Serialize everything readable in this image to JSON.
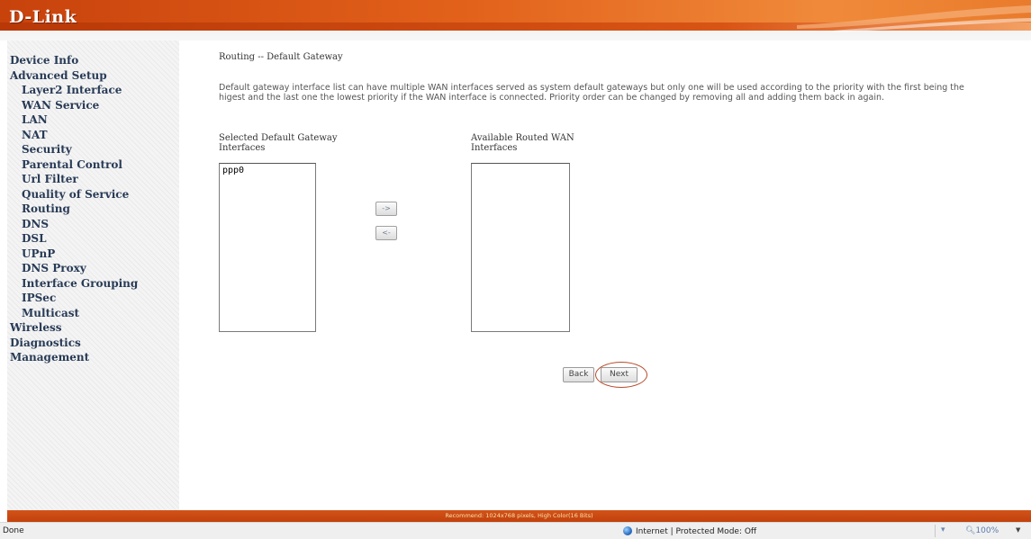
{
  "brand": {
    "logo_text": "D-Link"
  },
  "sidebar": {
    "items": [
      {
        "label": "Device Info",
        "level": 0
      },
      {
        "label": "Advanced Setup",
        "level": 0
      },
      {
        "label": "Layer2 Interface",
        "level": 1
      },
      {
        "label": "WAN Service",
        "level": 1
      },
      {
        "label": "LAN",
        "level": 1
      },
      {
        "label": "NAT",
        "level": 1
      },
      {
        "label": "Security",
        "level": 1
      },
      {
        "label": "Parental Control",
        "level": 1
      },
      {
        "label": "Url Filter",
        "level": 1
      },
      {
        "label": "Quality of Service",
        "level": 1
      },
      {
        "label": "Routing",
        "level": 1
      },
      {
        "label": "DNS",
        "level": 1
      },
      {
        "label": "DSL",
        "level": 1
      },
      {
        "label": "UPnP",
        "level": 1
      },
      {
        "label": "DNS Proxy",
        "level": 1
      },
      {
        "label": "Interface Grouping",
        "level": 1
      },
      {
        "label": "IPSec",
        "level": 1
      },
      {
        "label": "Multicast",
        "level": 1
      },
      {
        "label": "Wireless",
        "level": 0
      },
      {
        "label": "Diagnostics",
        "level": 0
      },
      {
        "label": "Management",
        "level": 0
      }
    ]
  },
  "page": {
    "title": "Routing -- Default Gateway",
    "description": "Default gateway interface list can have multiple WAN interfaces served as system default gateways but only one will be used according to the priority with the first being the higest and the last one the lowest priority if the WAN interface is connected. Priority order can be changed by removing all and adding them back in again.",
    "selected_label": "Selected Default Gateway Interfaces",
    "available_label": "Available Routed WAN Interfaces",
    "selected_options": [
      "ppp0"
    ],
    "available_options": [],
    "add_button": "->",
    "remove_button": "<-",
    "back_button": "Back",
    "next_button": "Next"
  },
  "footer": {
    "text": "Recommend: 1024x768 pixels, High Color(16 Bits)"
  },
  "statusbar": {
    "left_text": "Done",
    "zone_text": "Internet | Protected Mode: Off",
    "zoom_text": "100%"
  },
  "colors": {
    "accent": "#d94e10",
    "nav_text": "#273a56"
  }
}
